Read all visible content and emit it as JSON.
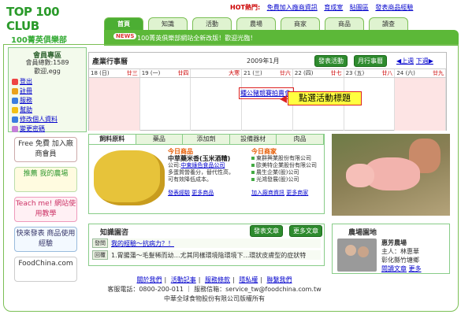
{
  "header": {
    "logo_brand": "TOP 100 CLUB",
    "logo_sub": "100菁英俱樂部",
    "hot_label": "HOT熱門:",
    "links": [
      "免費加入廠商資訊",
      "育成室",
      "貼圖區",
      "發表商品經驗"
    ]
  },
  "tabs": [
    "首頁",
    "知識",
    "活動",
    "農場",
    "商家",
    "商品",
    "讀查"
  ],
  "news": {
    "badge": "NEWS",
    "text": "100菁英俱樂部網站全新改版！歡迎光臨！"
  },
  "member": {
    "title": "會員專區",
    "count_label": "會員總數:1589",
    "greeting": "歡迎,egg",
    "links": [
      "登出",
      "註冊",
      "服務",
      "幫助",
      "修改個人資料",
      "變更密碼"
    ]
  },
  "promos": [
    "Free 免費 加入廠商會員",
    "推薦 我的農場",
    "Teach me! 網站使用教學",
    "快來發表 商品使用經驗",
    "FoodChina.com"
  ],
  "calendar": {
    "title": "產業行事曆",
    "month": "2009年1月",
    "btn_post": "發表活動",
    "btn_month": "月行事曆",
    "prev": "◀上週",
    "next": "下週▶",
    "days": [
      {
        "d": "18 (日)",
        "tag": "廿三"
      },
      {
        "d": "19 (一)",
        "tag": "廿四"
      },
      {
        "d": "20 (二)",
        "tag": "大寒"
      },
      {
        "d": "21 (三)",
        "tag": "廿六"
      },
      {
        "d": "22 (四)",
        "tag": "廿七"
      },
      {
        "d": "23 (五)",
        "tag": "廿八"
      },
      {
        "d": "24 (六)",
        "tag": "廿九"
      }
    ],
    "event": "種公豬競賽拍賣會",
    "callout": "點選活動標題"
  },
  "info": {
    "tabs": [
      "飼料原料",
      "藥品",
      "添加劑",
      "設備器材",
      "肉品"
    ],
    "today_product_h": "今日商品",
    "product_name": "中草藥米香(玉米酒糟)",
    "product_company_label": "公司:",
    "product_company": "中東綠色食品公司",
    "product_desc1": "多蛋質營養分，替代性高，",
    "product_desc2": "可有效降低成本。",
    "link_more_p": "發表經驗",
    "link_more_p2": "更多商品",
    "today_company_h": "今日商家",
    "companies": [
      "東群興業股份有限公司",
      "歐美特企業股份有限公司",
      "農生企業(股)公司",
      "光鴻發展(股)公司"
    ],
    "link_join": "加入廠商資訊",
    "link_more_c": "更多商家"
  },
  "knowledge": {
    "title": "知識園咨",
    "btn_post": "發表文章",
    "btn_more": "更多文章",
    "rows": [
      {
        "tag": "發問",
        "text": "我的經驗～抗病力？！"
      },
      {
        "tag": "回覆",
        "text": "1.胃腸蒲～毛髮稀而幼…尤其同樣環境陰環境下...環狀皮膚型的症狀特"
      }
    ]
  },
  "farm": {
    "title": "農場園地",
    "name": "惠芳農場",
    "owner": "主人：林惠華",
    "region": "彰化縣竹塘鄉",
    "link_read": "閱讀文章",
    "link_more": "更多"
  },
  "footer": {
    "links": [
      "關於我們",
      "活動記事",
      "服務條款",
      "隱私權",
      "聯繫我們"
    ],
    "contact": "客服電話：0800-200-011 ｜ 服務信箱：service_tw@foodchina.com.tw",
    "copyright": "中華全球食物股份有限公司版權所有"
  }
}
